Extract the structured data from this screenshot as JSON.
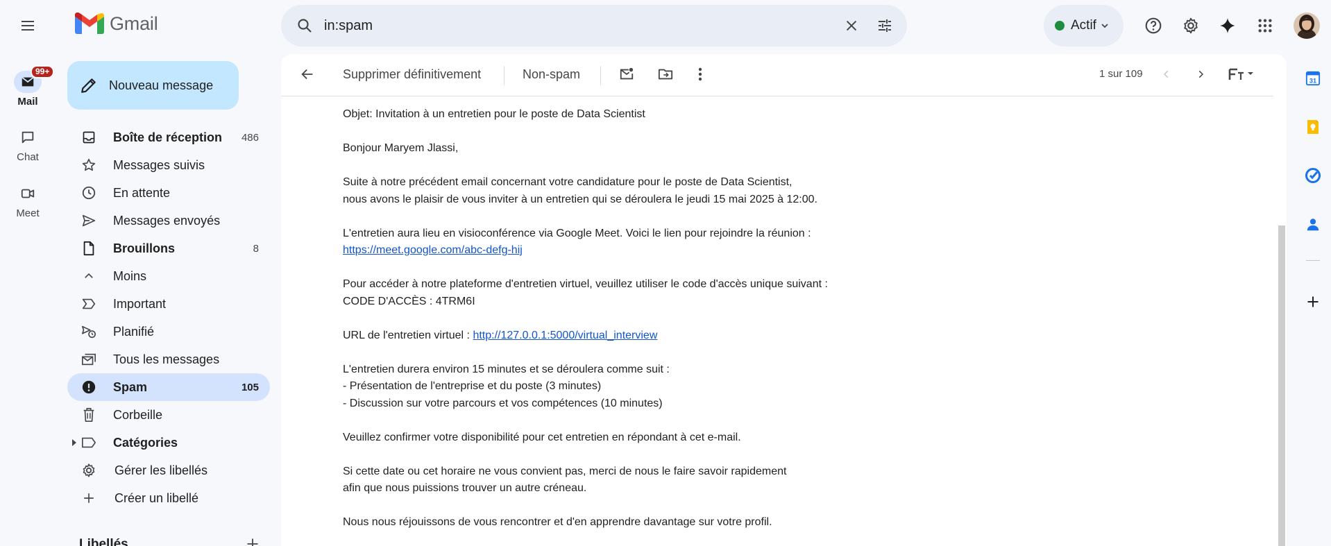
{
  "app": {
    "name": "Gmail"
  },
  "rail": {
    "items": [
      {
        "label": "Mail",
        "badge": "99+",
        "active": true
      },
      {
        "label": "Chat"
      },
      {
        "label": "Meet"
      }
    ]
  },
  "search": {
    "value": "in:spam"
  },
  "status": {
    "label": "Actif",
    "color": "#1e8e3e"
  },
  "compose": {
    "label": "Nouveau message"
  },
  "nav": {
    "items": [
      {
        "label": "Boîte de réception",
        "count": "486",
        "icon": "inbox-icon",
        "bold": true
      },
      {
        "label": "Messages suivis",
        "count": "",
        "icon": "star-icon"
      },
      {
        "label": "En attente",
        "count": "",
        "icon": "clock-icon"
      },
      {
        "label": "Messages envoyés",
        "count": "",
        "icon": "send-icon"
      },
      {
        "label": "Brouillons",
        "count": "8",
        "icon": "draft-icon",
        "bold": true
      },
      {
        "label": "Moins",
        "count": "",
        "icon": "chevron-up-icon"
      },
      {
        "label": "Important",
        "count": "",
        "icon": "important-icon"
      },
      {
        "label": "Planifié",
        "count": "",
        "icon": "scheduled-icon"
      },
      {
        "label": "Tous les messages",
        "count": "",
        "icon": "all-mail-icon"
      },
      {
        "label": "Spam",
        "count": "105",
        "icon": "spam-icon",
        "active": true
      },
      {
        "label": "Corbeille",
        "count": "",
        "icon": "trash-icon"
      },
      {
        "label": "Catégories",
        "count": "",
        "icon": "label-icon",
        "bold": true
      },
      {
        "label": "Gérer les libellés",
        "count": "",
        "icon": "gear-icon"
      },
      {
        "label": "Créer un libellé",
        "count": "",
        "icon": "plus-icon"
      }
    ],
    "labels_heading": "Libellés"
  },
  "toolbar": {
    "delete_forever": "Supprimer définitivement",
    "not_spam": "Non-spam",
    "pager": "1 sur 109"
  },
  "email": {
    "subject_line": "Objet: Invitation à un entretien pour le poste de Data Scientist",
    "greeting": "Bonjour Maryem Jlassi,",
    "p1_l1": "Suite à notre précédent email concernant votre candidature pour le poste de Data Scientist,",
    "p1_l2": "nous avons le plaisir de vous inviter à un entretien qui se déroulera le jeudi 15 mai 2025 à 12:00.",
    "p2_l1": "L'entretien aura lieu en visioconférence via Google Meet. Voici le lien pour rejoindre la réunion :",
    "meet_link": "https://meet.google.com/abc-defg-hij",
    "p3_l1": "Pour accéder à notre plateforme d'entretien virtuel, veuillez utiliser le code d'accès unique suivant :",
    "p3_l2": "CODE D'ACCÈS : 4TRM6I",
    "p4_prefix": "URL de l'entretien virtuel : ",
    "interview_link": "http://127.0.0.1:5000/virtual_interview",
    "p5_l1": "L'entretien durera environ 15 minutes et se déroulera comme suit :",
    "p5_l2": "- Présentation de l'entreprise et du poste (3 minutes)",
    "p5_l3": "- Discussion sur votre parcours et vos compétences (10 minutes)",
    "p6_l1": "Veuillez confirmer votre disponibilité pour cet entretien en répondant à cet e-mail.",
    "p7_l1": "Si cette date ou cet horaire ne vous convient pas, merci de nous le faire savoir rapidement",
    "p7_l2": "afin que nous puissions trouver un autre créneau.",
    "p8_l1": "Nous nous réjouissons de vous rencontrer et d'en apprendre davantage sur votre profil."
  },
  "side_panel": {
    "calendar_day": "31"
  },
  "colors": {
    "accent": "#0b57d0",
    "compose_bg": "#c2e7ff",
    "active_nav": "#d3e3fd",
    "badge_red": "#b3261e",
    "link": "#1155cc"
  }
}
